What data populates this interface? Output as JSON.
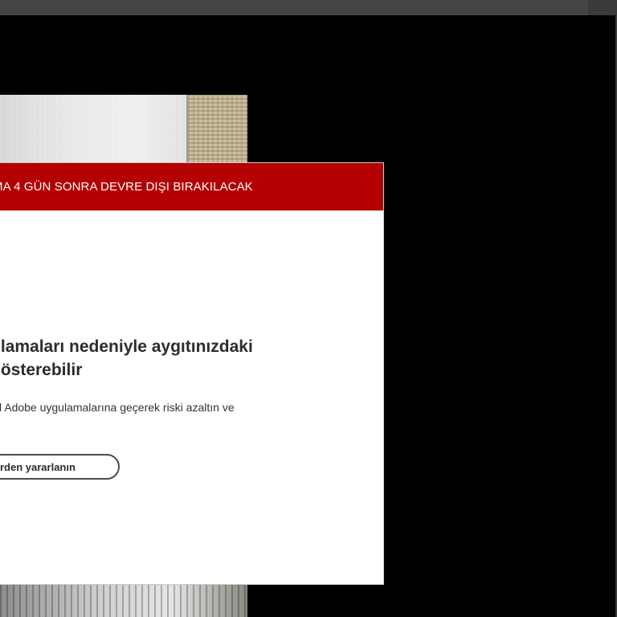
{
  "banner": {
    "text": "MA 4 GÜN SONRA DEVRE DIŞI BIRAKILACAK"
  },
  "dialog": {
    "headline_line1": "ulamaları nedeniyle aygıtınızdaki",
    "headline_line2": "gösterebilir",
    "body": "l Adobe uygulamalarına geçerek riski azaltın ve",
    "cta_label": "rden yararlanın"
  },
  "colors": {
    "banner": "#b40000",
    "background": "#000000",
    "dialog": "#ffffff"
  }
}
